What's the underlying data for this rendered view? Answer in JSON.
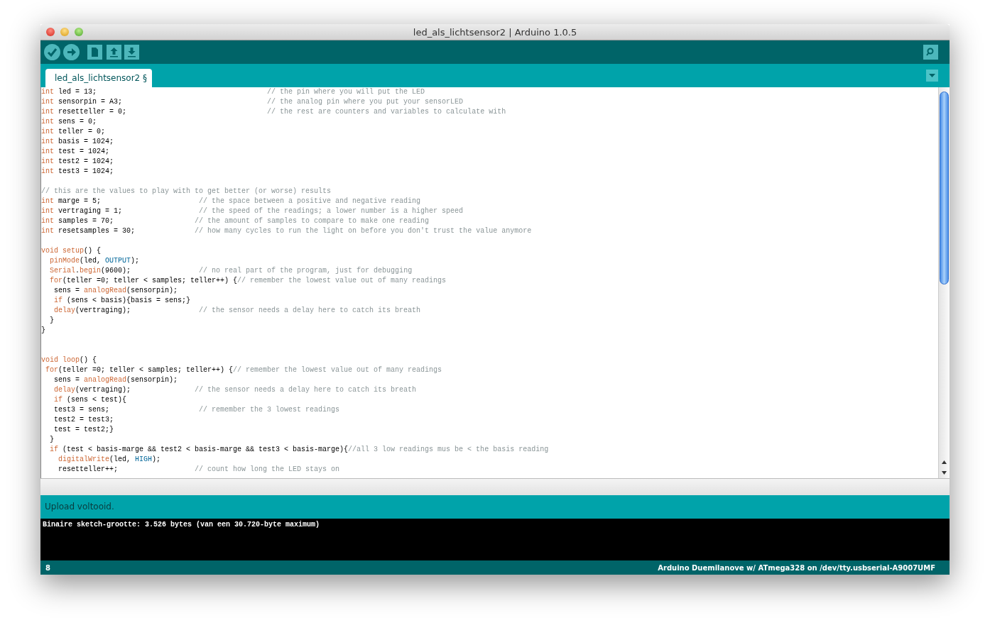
{
  "window": {
    "title": "led_als_lichtsensor2 | Arduino 1.0.5"
  },
  "tabs": [
    {
      "label": "led_als_lichtsensor2 §",
      "selected": true
    }
  ],
  "editor": {
    "lines": [
      {
        "kind": "code",
        "segments": [
          {
            "kind": "keyword",
            "text": "int"
          },
          {
            "kind": "plain",
            "text": " led = 13;                                        "
          },
          {
            "kind": "comment",
            "text": "// the pin where you will put the LED"
          }
        ]
      },
      {
        "kind": "code",
        "segments": [
          {
            "kind": "keyword",
            "text": "int"
          },
          {
            "kind": "plain",
            "text": " sensorpin = A3;                                  "
          },
          {
            "kind": "comment",
            "text": "// the analog pin where you put your sensorLED"
          }
        ]
      },
      {
        "kind": "code",
        "segments": [
          {
            "kind": "keyword",
            "text": "int"
          },
          {
            "kind": "plain",
            "text": " resetteller = 0;                                 "
          },
          {
            "kind": "comment",
            "text": "// the rest are counters and variables to calculate with"
          }
        ]
      },
      {
        "kind": "code",
        "segments": [
          {
            "kind": "keyword",
            "text": "int"
          },
          {
            "kind": "plain",
            "text": " sens = 0;"
          }
        ]
      },
      {
        "kind": "code",
        "segments": [
          {
            "kind": "keyword",
            "text": "int"
          },
          {
            "kind": "plain",
            "text": " teller = 0;"
          }
        ]
      },
      {
        "kind": "code",
        "segments": [
          {
            "kind": "keyword",
            "text": "int"
          },
          {
            "kind": "plain",
            "text": " basis = 1024;"
          }
        ]
      },
      {
        "kind": "code",
        "segments": [
          {
            "kind": "keyword",
            "text": "int"
          },
          {
            "kind": "plain",
            "text": " test = 1024;"
          }
        ]
      },
      {
        "kind": "code",
        "segments": [
          {
            "kind": "keyword",
            "text": "int"
          },
          {
            "kind": "plain",
            "text": " test2 = 1024;"
          }
        ]
      },
      {
        "kind": "code",
        "segments": [
          {
            "kind": "keyword",
            "text": "int"
          },
          {
            "kind": "plain",
            "text": " test3 = 1024;"
          }
        ]
      },
      {
        "kind": "blank"
      },
      {
        "kind": "code",
        "segments": [
          {
            "kind": "comment",
            "text": "// this are the values to play with to get better (or worse) results"
          }
        ]
      },
      {
        "kind": "code",
        "segments": [
          {
            "kind": "keyword",
            "text": "int"
          },
          {
            "kind": "plain",
            "text": " marge = 5;                       "
          },
          {
            "kind": "comment",
            "text": "// the space between a positive and negative reading"
          }
        ]
      },
      {
        "kind": "code",
        "segments": [
          {
            "kind": "keyword",
            "text": "int"
          },
          {
            "kind": "plain",
            "text": " vertraging = 1;                  "
          },
          {
            "kind": "comment",
            "text": "// the speed of the readings; a lower number is a higher speed"
          }
        ]
      },
      {
        "kind": "code",
        "segments": [
          {
            "kind": "keyword",
            "text": "int"
          },
          {
            "kind": "plain",
            "text": " samples = 70;                   "
          },
          {
            "kind": "comment",
            "text": "// the amount of samples to compare to make one reading"
          }
        ]
      },
      {
        "kind": "code",
        "segments": [
          {
            "kind": "keyword",
            "text": "int"
          },
          {
            "kind": "plain",
            "text": " resetsamples = 30;              "
          },
          {
            "kind": "comment",
            "text": "// how many cycles to run the light on before you don't trust the value anymore"
          }
        ]
      },
      {
        "kind": "blank"
      },
      {
        "kind": "code",
        "segments": [
          {
            "kind": "keyword",
            "text": "void setup"
          },
          {
            "kind": "plain",
            "text": "() {"
          }
        ]
      },
      {
        "kind": "code",
        "segments": [
          {
            "kind": "keyword",
            "text": "  pinMode"
          },
          {
            "kind": "plain",
            "text": "(led, "
          },
          {
            "kind": "constant",
            "text": "OUTPUT"
          },
          {
            "kind": "plain",
            "text": ");"
          }
        ]
      },
      {
        "kind": "code",
        "segments": [
          {
            "kind": "keyword",
            "text": "  Serial"
          },
          {
            "kind": "plain",
            "text": "."
          },
          {
            "kind": "keyword",
            "text": "begin"
          },
          {
            "kind": "plain",
            "text": "(9600);                "
          },
          {
            "kind": "comment",
            "text": "// no real part of the program, just for debugging"
          }
        ]
      },
      {
        "kind": "code",
        "segments": [
          {
            "kind": "keyword",
            "text": "  for"
          },
          {
            "kind": "plain",
            "text": "(teller =0; teller < samples; teller++) {"
          },
          {
            "kind": "comment",
            "text": "// remember the lowest value out of many readings"
          }
        ]
      },
      {
        "kind": "code",
        "segments": [
          {
            "kind": "plain",
            "text": "   sens = "
          },
          {
            "kind": "keyword",
            "text": "analogRead"
          },
          {
            "kind": "plain",
            "text": "(sensorpin);"
          }
        ]
      },
      {
        "kind": "code",
        "segments": [
          {
            "kind": "keyword",
            "text": "   if"
          },
          {
            "kind": "plain",
            "text": " (sens < basis){basis = sens;}"
          }
        ]
      },
      {
        "kind": "code",
        "segments": [
          {
            "kind": "keyword",
            "text": "   delay"
          },
          {
            "kind": "plain",
            "text": "(vertraging);                "
          },
          {
            "kind": "comment",
            "text": "// the sensor needs a delay here to catch its breath"
          }
        ]
      },
      {
        "kind": "code",
        "segments": [
          {
            "kind": "plain",
            "text": "  }"
          }
        ]
      },
      {
        "kind": "code",
        "segments": [
          {
            "kind": "plain",
            "text": "}"
          }
        ]
      },
      {
        "kind": "blank"
      },
      {
        "kind": "blank"
      },
      {
        "kind": "code",
        "segments": [
          {
            "kind": "keyword",
            "text": "void loop"
          },
          {
            "kind": "plain",
            "text": "() {"
          }
        ]
      },
      {
        "kind": "code",
        "segments": [
          {
            "kind": "keyword",
            "text": " for"
          },
          {
            "kind": "plain",
            "text": "(teller =0; teller < samples; teller++) {"
          },
          {
            "kind": "comment",
            "text": "// remember the lowest value out of many readings"
          }
        ]
      },
      {
        "kind": "code",
        "segments": [
          {
            "kind": "plain",
            "text": "   sens = "
          },
          {
            "kind": "keyword",
            "text": "analogRead"
          },
          {
            "kind": "plain",
            "text": "(sensorpin);"
          }
        ]
      },
      {
        "kind": "code",
        "segments": [
          {
            "kind": "keyword",
            "text": "   delay"
          },
          {
            "kind": "plain",
            "text": "(vertraging);               "
          },
          {
            "kind": "comment",
            "text": "// the sensor needs a delay here to catch its breath"
          }
        ]
      },
      {
        "kind": "code",
        "segments": [
          {
            "kind": "keyword",
            "text": "   if"
          },
          {
            "kind": "plain",
            "text": " (sens < test){"
          }
        ]
      },
      {
        "kind": "code",
        "segments": [
          {
            "kind": "plain",
            "text": "   test3 = sens;                     "
          },
          {
            "kind": "comment",
            "text": "// remember the 3 lowest readings"
          }
        ]
      },
      {
        "kind": "code",
        "segments": [
          {
            "kind": "plain",
            "text": "   test2 = test3;"
          }
        ]
      },
      {
        "kind": "code",
        "segments": [
          {
            "kind": "plain",
            "text": "   test = test2;}"
          }
        ]
      },
      {
        "kind": "code",
        "segments": [
          {
            "kind": "plain",
            "text": "  }"
          }
        ]
      },
      {
        "kind": "code",
        "segments": [
          {
            "kind": "keyword",
            "text": "  if"
          },
          {
            "kind": "plain",
            "text": " (test < basis-marge && test2 < basis-marge && test3 < basis-marge){"
          },
          {
            "kind": "comment",
            "text": "//all 3 low readings mus be < the basis reading"
          }
        ]
      },
      {
        "kind": "code",
        "segments": [
          {
            "kind": "keyword",
            "text": "    digitalWrite"
          },
          {
            "kind": "plain",
            "text": "(led, "
          },
          {
            "kind": "constant",
            "text": "HIGH"
          },
          {
            "kind": "plain",
            "text": ");"
          }
        ]
      },
      {
        "kind": "code",
        "segments": [
          {
            "kind": "plain",
            "text": "    resetteller++;                  "
          },
          {
            "kind": "comment",
            "text": "// count how long the LED stays on"
          }
        ]
      }
    ]
  },
  "message": "Upload voltooid.",
  "console": [
    "Binaire sketch-grootte: 3.526 bytes (van een 30.720-byte maximum)"
  ],
  "status_bar": {
    "line": "8",
    "board": "Arduino Duemilanove w/ ATmega328 on /dev/tty.usbserial-A9007UMF"
  }
}
